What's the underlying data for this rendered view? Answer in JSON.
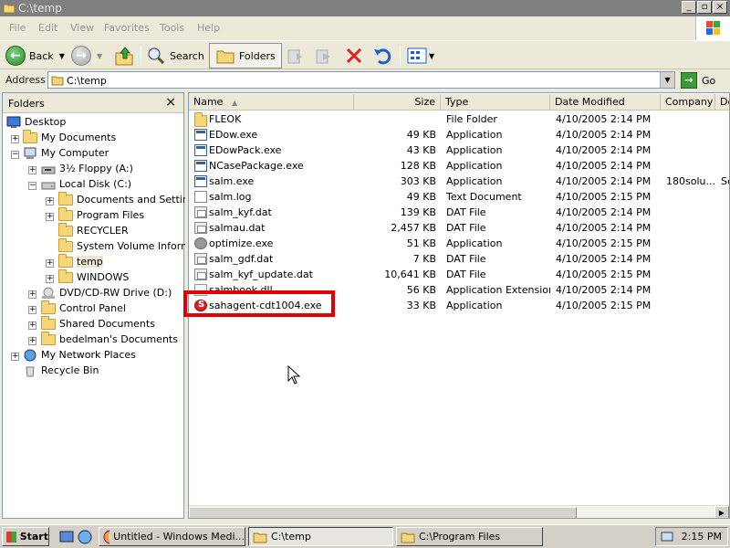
{
  "window": {
    "title": "C:\\temp"
  },
  "menu": [
    "File",
    "Edit",
    "View",
    "Favorites",
    "Tools",
    "Help"
  ],
  "toolbar": {
    "back": "Back",
    "search": "Search",
    "folders": "Folders"
  },
  "address": {
    "label": "Address",
    "value": "C:\\temp",
    "go": "Go"
  },
  "folders_pane": {
    "title": "Folders",
    "items": [
      {
        "label": "Desktop"
      },
      {
        "label": "My Documents"
      },
      {
        "label": "My Computer"
      },
      {
        "label": "3½ Floppy (A:)"
      },
      {
        "label": "Local Disk (C:)"
      },
      {
        "label": "Documents and Settings"
      },
      {
        "label": "Program Files"
      },
      {
        "label": "RECYCLER"
      },
      {
        "label": "System Volume Informat"
      },
      {
        "label": "temp",
        "selected": true
      },
      {
        "label": "WINDOWS"
      },
      {
        "label": "DVD/CD-RW Drive (D:)"
      },
      {
        "label": "Control Panel"
      },
      {
        "label": "Shared Documents"
      },
      {
        "label": "bedelman's Documents"
      },
      {
        "label": "My Network Places"
      },
      {
        "label": "Recycle Bin"
      }
    ]
  },
  "list": {
    "columns": [
      "Name",
      "Size",
      "Type",
      "Date Modified",
      "Company",
      "De"
    ],
    "rows": [
      {
        "name": "FLEOK",
        "size": "",
        "type": "File Folder",
        "date": "4/10/2005 2:14 PM",
        "company": "",
        "icon": "folder-icon"
      },
      {
        "name": "EDow.exe",
        "size": "49 KB",
        "type": "Application",
        "date": "4/10/2005 2:14 PM",
        "company": "",
        "icon": "exe-icon"
      },
      {
        "name": "EDowPack.exe",
        "size": "43 KB",
        "type": "Application",
        "date": "4/10/2005 2:14 PM",
        "company": "",
        "icon": "exe-icon"
      },
      {
        "name": "NCasePackage.exe",
        "size": "128 KB",
        "type": "Application",
        "date": "4/10/2005 2:14 PM",
        "company": "",
        "icon": "exe-icon"
      },
      {
        "name": "salm.exe",
        "size": "303 KB",
        "type": "Application",
        "date": "4/10/2005 2:14 PM",
        "company": "180solu...",
        "desc": "Se",
        "icon": "exe-icon"
      },
      {
        "name": "salm.log",
        "size": "49 KB",
        "type": "Text Document",
        "date": "4/10/2005 2:15 PM",
        "company": "",
        "icon": "text-file-icon"
      },
      {
        "name": "salm_kyf.dat",
        "size": "139 KB",
        "type": "DAT File",
        "date": "4/10/2005 2:14 PM",
        "company": "",
        "icon": "dat-file-icon"
      },
      {
        "name": "salmau.dat",
        "size": "2,457 KB",
        "type": "DAT File",
        "date": "4/10/2005 2:14 PM",
        "company": "",
        "icon": "dat-file-icon"
      },
      {
        "name": "optimize.exe",
        "size": "51 KB",
        "type": "Application",
        "date": "4/10/2005 2:15 PM",
        "company": "",
        "icon": "gear-icon"
      },
      {
        "name": "salm_gdf.dat",
        "size": "7 KB",
        "type": "DAT File",
        "date": "4/10/2005 2:14 PM",
        "company": "",
        "icon": "dat-file-icon"
      },
      {
        "name": "salm_kyf_update.dat",
        "size": "10,641 KB",
        "type": "DAT File",
        "date": "4/10/2005 2:15 PM",
        "company": "",
        "icon": "dat-file-icon"
      },
      {
        "name": "salmbook.dll",
        "size": "56 KB",
        "type": "Application Extension",
        "date": "4/10/2005 2:14 PM",
        "company": "",
        "icon": "dll-icon"
      },
      {
        "name": "sahagent-cdt1004.exe",
        "size": "33 KB",
        "type": "Application",
        "date": "4/10/2005 2:15 PM",
        "company": "",
        "icon": "red-s-app-icon"
      }
    ]
  },
  "taskbar": {
    "start": "Start",
    "tasks": [
      "Untitled - Windows Medi...",
      "C:\\temp",
      "C:\\Program Files"
    ],
    "clock": "2:15 PM"
  }
}
